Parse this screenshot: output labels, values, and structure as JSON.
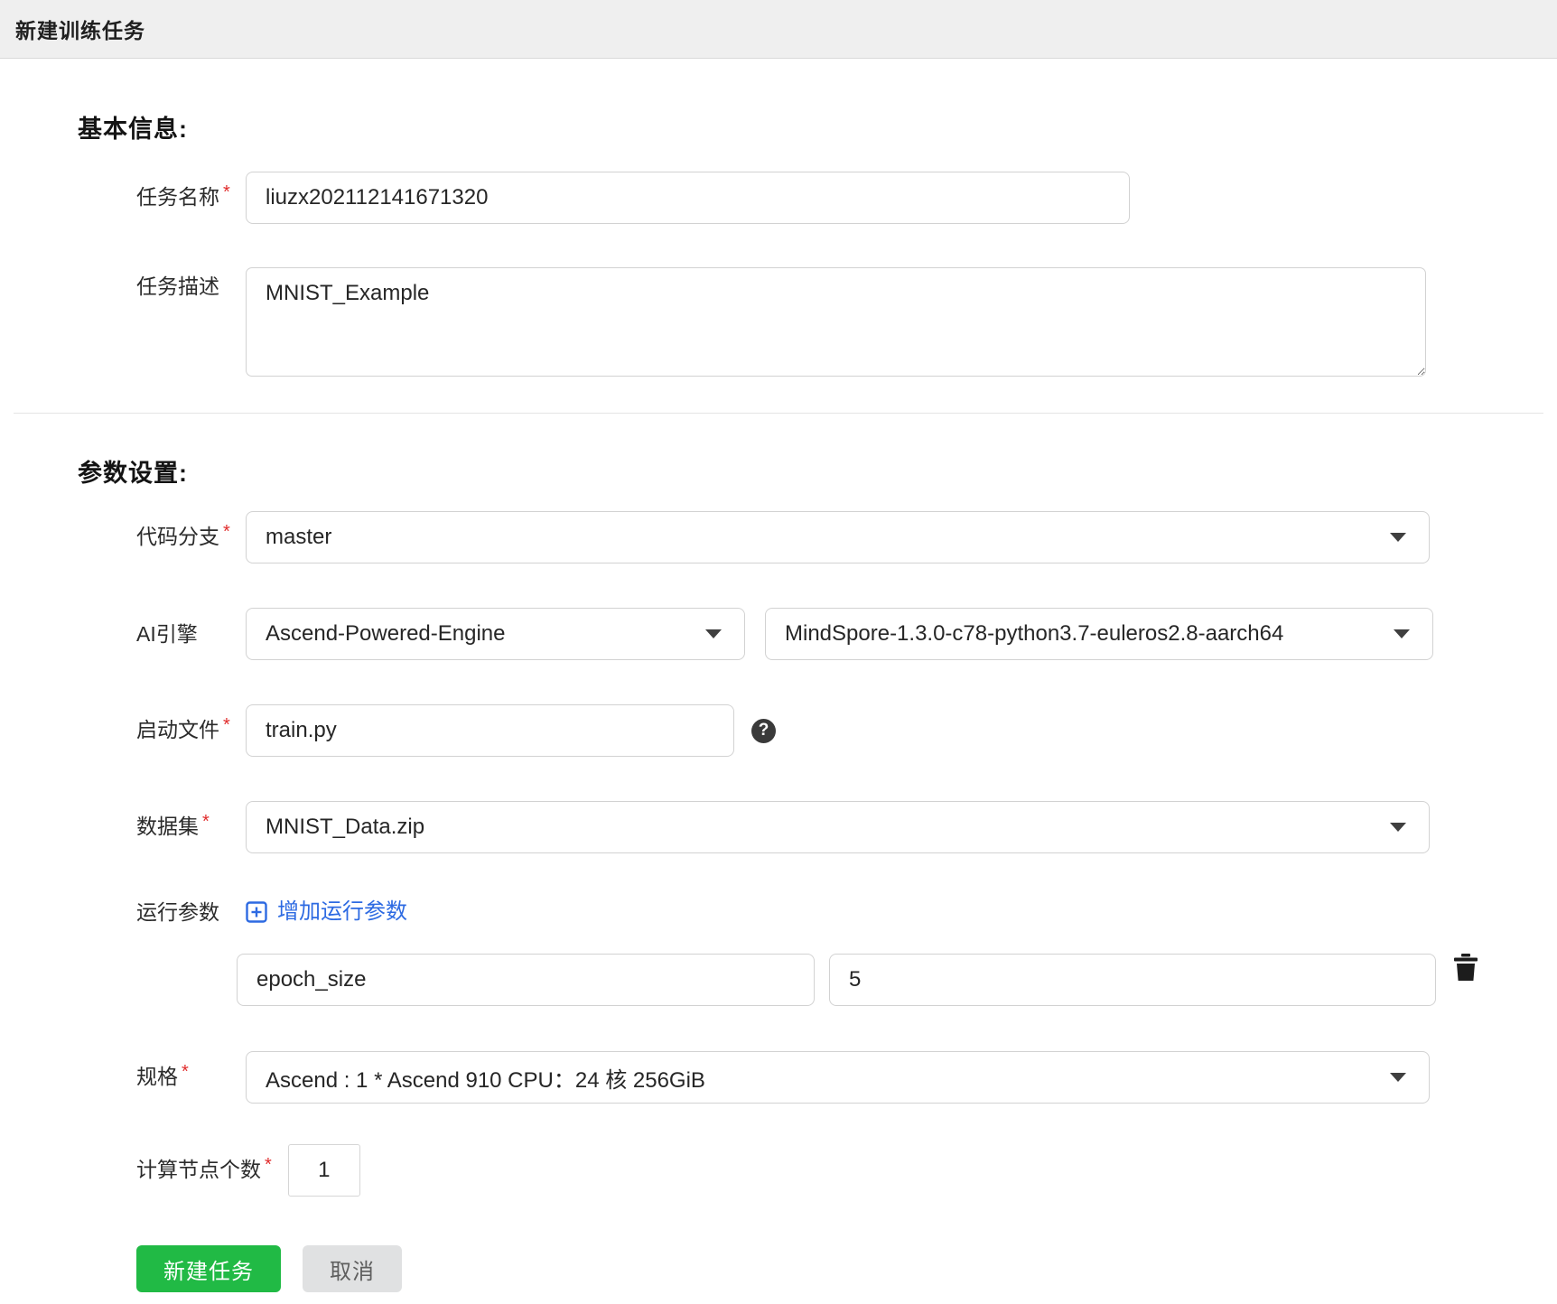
{
  "header": {
    "title": "新建训练任务"
  },
  "sections": {
    "basic_heading": "基本信息:",
    "params_heading": "参数设置:"
  },
  "fields": {
    "task_name": {
      "label": "任务名称",
      "required_mark": "*",
      "value": "liuzx202112141671320"
    },
    "task_desc": {
      "label": "任务描述",
      "value": "MNIST_Example"
    },
    "code_branch": {
      "label": "代码分支",
      "required_mark": "*",
      "value": "master"
    },
    "ai_engine": {
      "label": "AI引擎",
      "engine": "Ascend-Powered-Engine",
      "version": "MindSpore-1.3.0-c78-python3.7-euleros2.8-aarch64"
    },
    "boot_file": {
      "label": "启动文件",
      "required_mark": "*",
      "value": "train.py"
    },
    "dataset": {
      "label": "数据集",
      "required_mark": "*",
      "value": "MNIST_Data.zip"
    },
    "run_params": {
      "label": "运行参数",
      "add_label": "增加运行参数",
      "rows": [
        {
          "key": "epoch_size",
          "value": "5"
        }
      ]
    },
    "spec": {
      "label": "规格",
      "required_mark": "*",
      "value": "Ascend : 1 * Ascend 910 CPU：24 核 256GiB"
    },
    "node_count": {
      "label": "计算节点个数",
      "required_mark": "*",
      "value": "1"
    }
  },
  "buttons": {
    "submit": "新建任务",
    "cancel": "取消"
  },
  "icons": {
    "help": "?"
  },
  "colors": {
    "header_bg": "#efefef",
    "input_border": "#d2d2d2",
    "link_blue": "#2d6ae2",
    "button_green": "#21ba45",
    "cancel_gray": "#e0e1e2",
    "required_red": "#e02b2b"
  }
}
